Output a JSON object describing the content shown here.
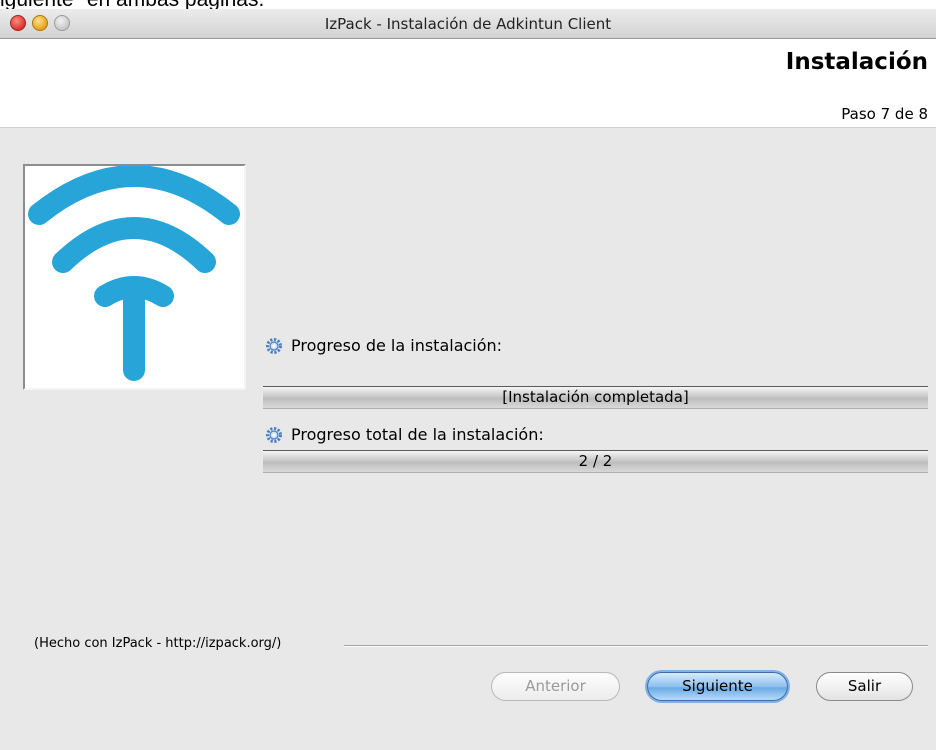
{
  "document": {
    "text": "iguiente\" en ambas páginas."
  },
  "window": {
    "title": "IzPack - Instalación de Adkintun Client"
  },
  "header": {
    "title": "Instalación",
    "step": "Paso 7 de 8"
  },
  "progress": {
    "pack_label": "Progreso de la instalación:",
    "pack_status": "[Instalación completada]",
    "pack_fraction": 1.0,
    "total_label": "Progreso total de la instalación:",
    "total_status": "2 / 2",
    "total_fraction": 1.0
  },
  "footer": {
    "credit": "(Hecho con IzPack - http://izpack.org/)"
  },
  "buttons": {
    "previous": "Anterior",
    "next": "Siguiente",
    "quit": "Salir"
  },
  "colors": {
    "logo_blue": "#27a5d8",
    "accent_button": "#6aaae6"
  },
  "icons": {
    "progress_icon": "gear-icon",
    "logo": "antenna-logo"
  }
}
